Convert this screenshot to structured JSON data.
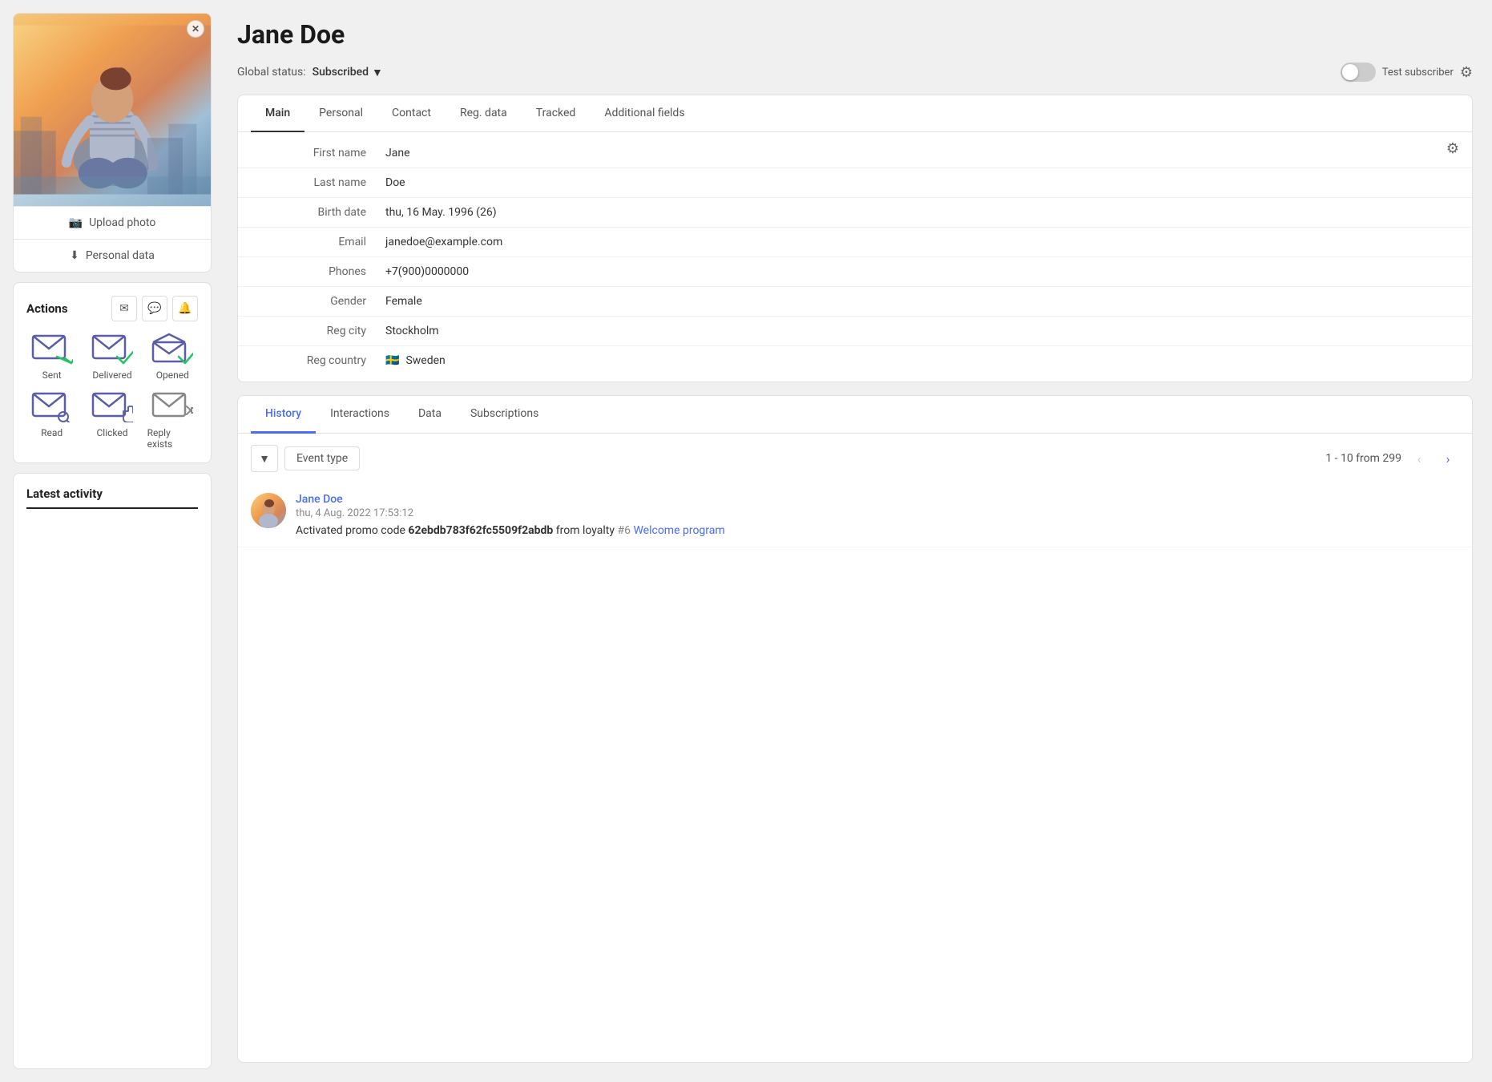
{
  "profile": {
    "name": "Jane Doe",
    "global_status_label": "Global status:",
    "status": "Subscribed",
    "test_subscriber_label": "Test subscriber",
    "tabs": [
      {
        "id": "main",
        "label": "Main",
        "active": true
      },
      {
        "id": "personal",
        "label": "Personal",
        "active": false
      },
      {
        "id": "contact",
        "label": "Contact",
        "active": false
      },
      {
        "id": "reg_data",
        "label": "Reg. data",
        "active": false
      },
      {
        "id": "tracked",
        "label": "Tracked",
        "active": false
      },
      {
        "id": "additional",
        "label": "Additional fields",
        "active": false
      }
    ],
    "fields": [
      {
        "label": "First name",
        "value": "Jane"
      },
      {
        "label": "Last name",
        "value": "Doe"
      },
      {
        "label": "Birth date",
        "value": "thu, 16 May. 1996 (26)"
      },
      {
        "label": "Email",
        "value": "janedoe@example.com"
      },
      {
        "label": "Phones",
        "value": "+7(900)0000000"
      },
      {
        "label": "Gender",
        "value": "Female"
      },
      {
        "label": "Reg city",
        "value": "Stockholm"
      },
      {
        "label": "Reg country",
        "value": "Sweden",
        "flag": "🇸🇪"
      }
    ]
  },
  "sidebar": {
    "upload_photo_label": "Upload photo",
    "personal_data_label": "Personal data",
    "actions_title": "Actions",
    "email_actions": [
      {
        "id": "sent",
        "label": "Sent"
      },
      {
        "id": "delivered",
        "label": "Delivered"
      },
      {
        "id": "opened",
        "label": "Opened"
      },
      {
        "id": "read",
        "label": "Read"
      },
      {
        "id": "clicked",
        "label": "Clicked"
      },
      {
        "id": "reply",
        "label": "Reply exists"
      }
    ],
    "latest_activity_title": "Latest activity"
  },
  "history": {
    "tabs": [
      {
        "id": "history",
        "label": "History",
        "active": true
      },
      {
        "id": "interactions",
        "label": "Interactions",
        "active": false
      },
      {
        "id": "data",
        "label": "Data",
        "active": false
      },
      {
        "id": "subscriptions",
        "label": "Subscriptions",
        "active": false
      }
    ],
    "filter_label": "Event type",
    "pagination": {
      "range": "1 - 10 from 299",
      "prev_disabled": true
    },
    "entry": {
      "author": "Jane Doe",
      "time": "thu, 4 Aug. 2022 17:53:12",
      "promo_code": "62ebdb783f62fc5509f2abdb",
      "text_before": "Activated promo code ",
      "text_after": " from loyalty ",
      "loyalty_hash": "#6",
      "loyalty_link": "Welcome program"
    }
  },
  "icons": {
    "camera": "📷",
    "download": "⬇",
    "email": "✉",
    "chat": "💬",
    "bell": "🔔",
    "gear": "⚙",
    "filter": "▼",
    "chevron_left": "‹",
    "chevron_right": "›",
    "close": "✕"
  },
  "colors": {
    "accent": "#4a6cf7",
    "sent_icon": "#5b5ea6",
    "delivered_icon": "#5b5ea6",
    "opened_icon": "#5b5ea6",
    "read_icon": "#5b5ea6",
    "clicked_icon": "#5b5ea6",
    "reply_icon": "#555"
  }
}
